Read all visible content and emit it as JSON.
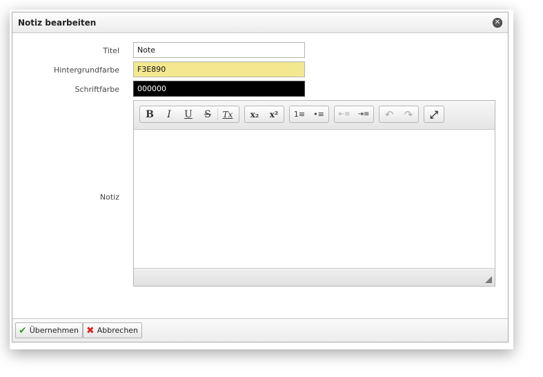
{
  "dialog": {
    "title": "Notiz bearbeiten",
    "close_symbol": "✕"
  },
  "form": {
    "title_label": "Titel",
    "title_value": "Note",
    "bg_label": "Hintergrundfarbe",
    "bg_value": "F3E890",
    "bg_color": "#F3E890",
    "font_label": "Schriftfarbe",
    "font_value": "000000",
    "font_color": "#000000",
    "note_label": "Notiz"
  },
  "toolbar": {
    "bold": "B",
    "italic": "I",
    "underline": "U",
    "strike": "S",
    "remove_format": "Tx",
    "subscript": "x₂",
    "superscript": "x²",
    "ordered_list": "1≡",
    "bullet_list": "•≡",
    "outdent": "⇤≡",
    "indent": "⇥≡",
    "undo": "↶",
    "redo": "↷",
    "maximize": "⤢"
  },
  "footer": {
    "apply_label": "Übernehmen",
    "apply_icon": "checkmark-icon",
    "cancel_label": "Abbrechen",
    "cancel_icon": "cross-icon"
  }
}
